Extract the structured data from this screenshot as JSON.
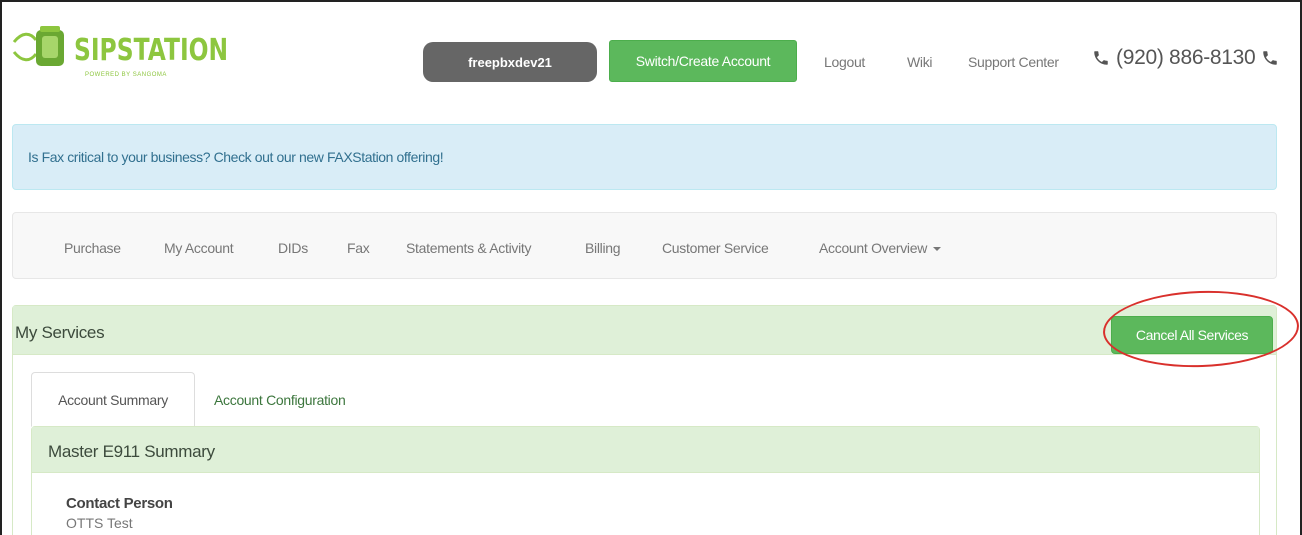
{
  "header": {
    "logo_text": "SIPSTATION",
    "logo_tagline": "POWERED BY SANGOMA",
    "account_name": "freepbxdev21",
    "switch_label": "Switch/Create Account",
    "links": [
      "Logout",
      "Wiki",
      "Support Center"
    ],
    "phone": "(920) 886-8130"
  },
  "alert": {
    "text": "Is Fax critical to your business? Check out our new FAXStation offering!"
  },
  "nav": {
    "items": [
      "Purchase",
      "My Account",
      "DIDs",
      "Fax",
      "Statements & Activity",
      "Billing",
      "Customer Service",
      "Account Overview"
    ]
  },
  "services": {
    "title": "My Services",
    "cancel_label": "Cancel All Services",
    "tabs": [
      "Account Summary",
      "Account Configuration"
    ],
    "summary_title": "Master E911 Summary",
    "contact_label": "Contact Person",
    "contact_value": "OTTS Test"
  },
  "colors": {
    "brand_green": "#8dc63f",
    "button_green": "#5cb85c",
    "panel_green": "#dff0d8",
    "alert_blue": "#d9edf7",
    "highlight_ring": "#d9302c"
  }
}
